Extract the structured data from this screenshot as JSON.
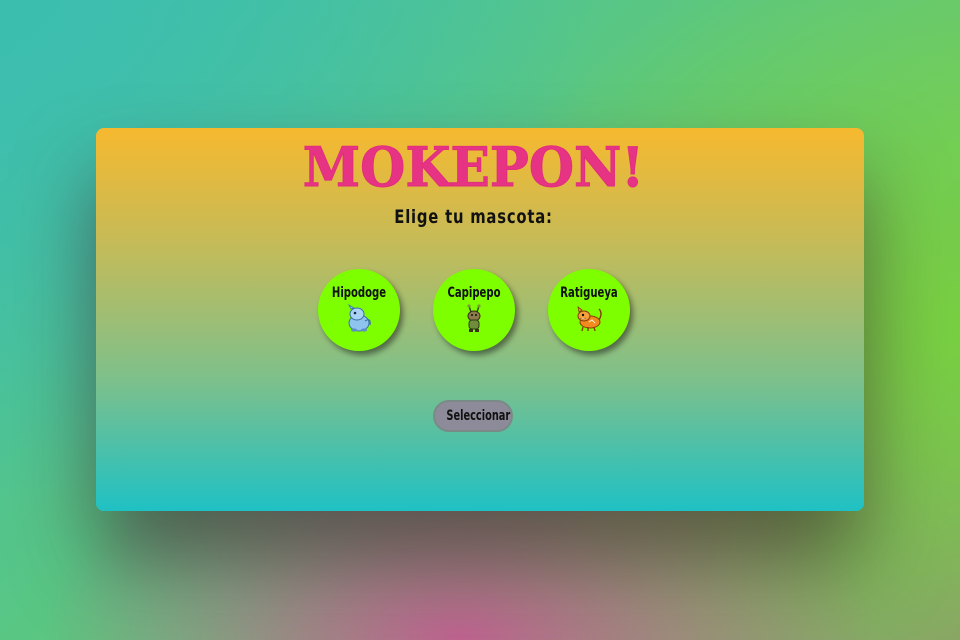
{
  "app": {
    "title": "MOKEPON!",
    "subtitle": "Elige tu mascota:"
  },
  "pets": [
    {
      "name": "Hipodoge",
      "icon": "hipodoge-icon",
      "color": "#7dff00"
    },
    {
      "name": "Capipepo",
      "icon": "capipepo-icon",
      "color": "#7dff00"
    },
    {
      "name": "Ratigueya",
      "icon": "ratigueya-icon",
      "color": "#7dff00"
    }
  ],
  "actions": {
    "select_label": "Seleccionar"
  },
  "colors": {
    "title": "#e63383",
    "card_top": "#f6b92f",
    "card_bottom": "#1fc1c4",
    "pet_bg": "#7dff00",
    "button_bg": "#8d8a99"
  }
}
